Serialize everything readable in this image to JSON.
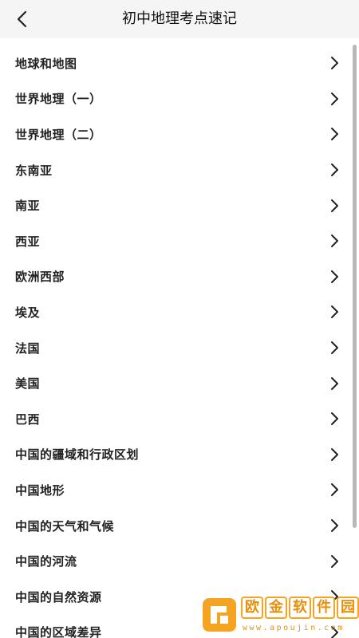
{
  "header": {
    "title": "初中地理考点速记",
    "back_icon": "chevron-left-icon"
  },
  "list": {
    "items": [
      {
        "label": "地球和地图"
      },
      {
        "label": "世界地理（一）"
      },
      {
        "label": "世界地理（二）"
      },
      {
        "label": "东南亚"
      },
      {
        "label": "南亚"
      },
      {
        "label": "西亚"
      },
      {
        "label": "欧洲西部"
      },
      {
        "label": "埃及"
      },
      {
        "label": "法国"
      },
      {
        "label": "美国"
      },
      {
        "label": "巴西"
      },
      {
        "label": "中国的疆域和行政区划"
      },
      {
        "label": "中国地形"
      },
      {
        "label": "中国的天气和气候"
      },
      {
        "label": "中国的河流"
      },
      {
        "label": "中国的自然资源"
      },
      {
        "label": "中国的区域差异"
      }
    ],
    "item_icon": "chevron-right-icon"
  },
  "watermark": {
    "chars": [
      "欧",
      "金",
      "软",
      "件",
      "园"
    ],
    "url": "www.apoujin.com",
    "accent_color": "#f4a420"
  }
}
